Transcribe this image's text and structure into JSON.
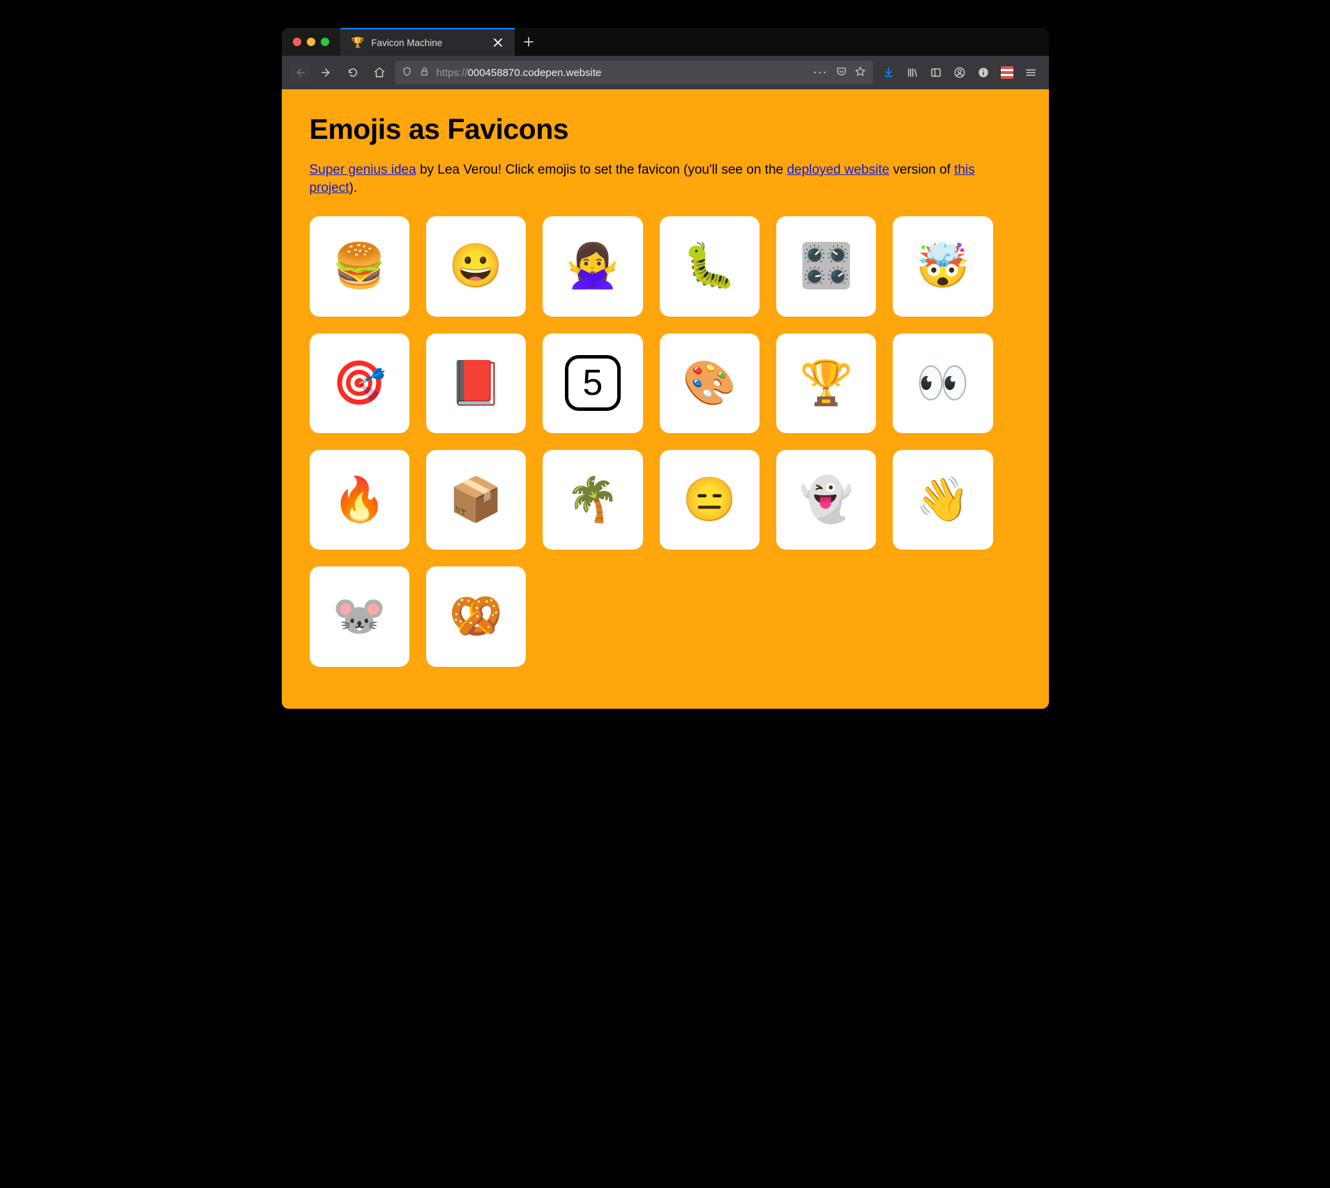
{
  "browser": {
    "tab": {
      "favicon": "🏆",
      "title": "Favicon Machine"
    },
    "url": {
      "protocol": "https://",
      "host": "000458870.codepen.website",
      "path": ""
    }
  },
  "page": {
    "heading": "Emojis as Favicons",
    "intro": {
      "link1_text": "Super genius idea",
      "text1": " by Lea Verou! Click emojis to set the favicon (you'll see on the ",
      "link2_text": "deployed website",
      "text2": " version of ",
      "link3_text": "this project",
      "text3": ")."
    },
    "emojis": [
      {
        "name": "hamburger",
        "char": "🍔"
      },
      {
        "name": "grinning-face",
        "char": "😀"
      },
      {
        "name": "no-good-woman",
        "char": "🙅‍♀️"
      },
      {
        "name": "caterpillar",
        "char": "🐛"
      },
      {
        "name": "control-knobs",
        "char": "🎛️"
      },
      {
        "name": "exploding-head",
        "char": "🤯"
      },
      {
        "name": "direct-hit",
        "char": "🎯"
      },
      {
        "name": "closed-book",
        "char": "📕"
      },
      {
        "name": "keycap-5",
        "char": "5"
      },
      {
        "name": "artist-palette",
        "char": "🎨"
      },
      {
        "name": "trophy",
        "char": "🏆"
      },
      {
        "name": "eyes",
        "char": "👀"
      },
      {
        "name": "fire",
        "char": "🔥"
      },
      {
        "name": "package",
        "char": "📦"
      },
      {
        "name": "palm-tree",
        "char": "🌴"
      },
      {
        "name": "expressionless-face",
        "char": "😑"
      },
      {
        "name": "ghost",
        "char": "👻"
      },
      {
        "name": "waving-hand",
        "char": "👋"
      },
      {
        "name": "mouse-face",
        "char": "🐭"
      },
      {
        "name": "pretzel",
        "char": "🥨"
      }
    ]
  }
}
